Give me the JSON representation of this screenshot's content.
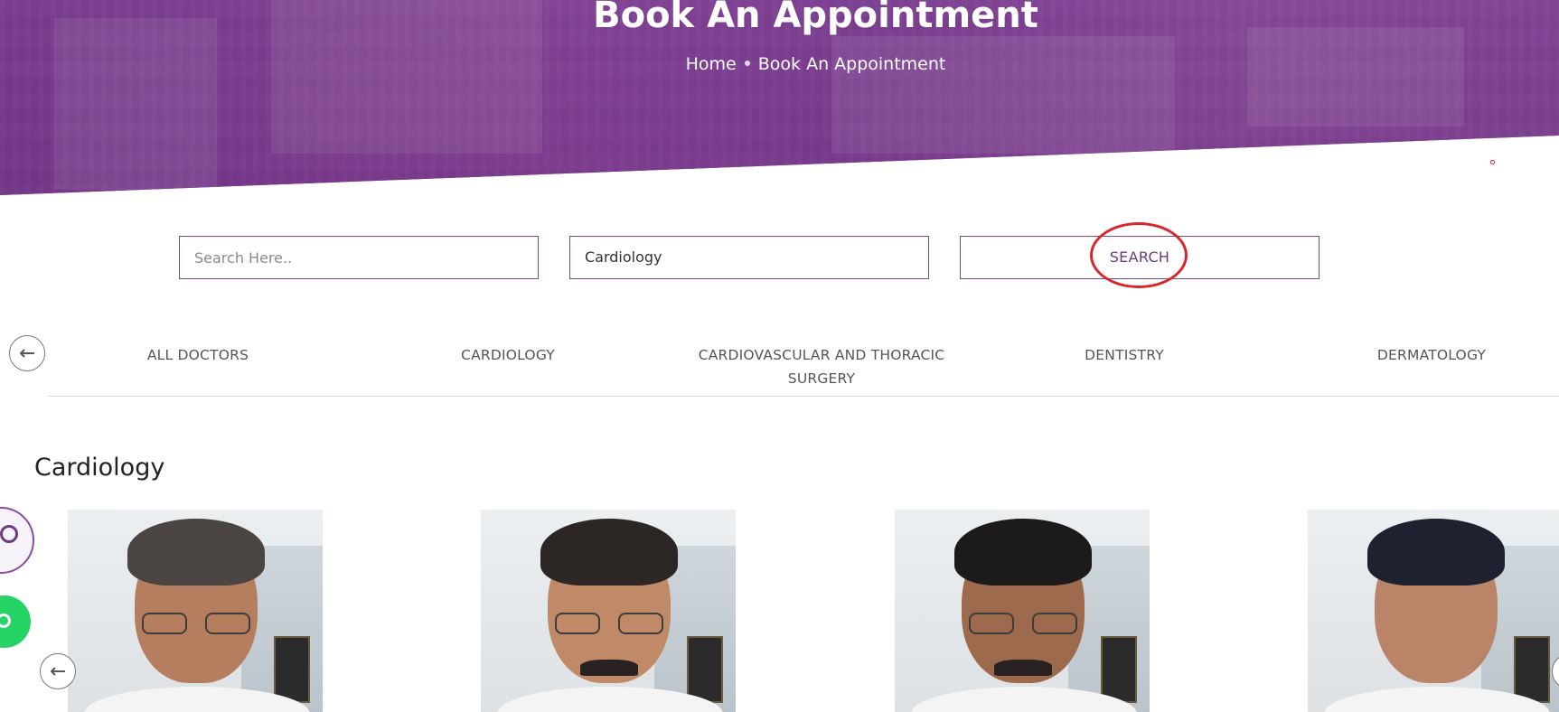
{
  "hero": {
    "title": "Book An Appointment",
    "breadcrumb": {
      "home": "Home",
      "current": "Book An Appointment"
    }
  },
  "search": {
    "input_placeholder": "Search Here..",
    "input_value": "",
    "specialty_value": "Cardiology",
    "button_label": "SEARCH"
  },
  "tabs": [
    {
      "label": "ALL DOCTORS"
    },
    {
      "label": "CARDIOLOGY"
    },
    {
      "label": "CARDIOVASCULAR AND THORACIC SURGERY"
    },
    {
      "label": "DENTISTRY"
    },
    {
      "label": "DERMATOLOGY"
    }
  ],
  "section": {
    "title": "Cardiology"
  },
  "doctors_count_visible": 4,
  "icons": {
    "tabs_prev": "arrow-left-icon",
    "carousel_prev": "arrow-left-icon",
    "whatsapp": "whatsapp-icon",
    "brand": "brand-logo"
  },
  "colors": {
    "brand_purple": "#7b4a8e",
    "search_text": "#6d3b82",
    "highlight_red": "#d9262b",
    "whatsapp_green": "#25d366"
  }
}
